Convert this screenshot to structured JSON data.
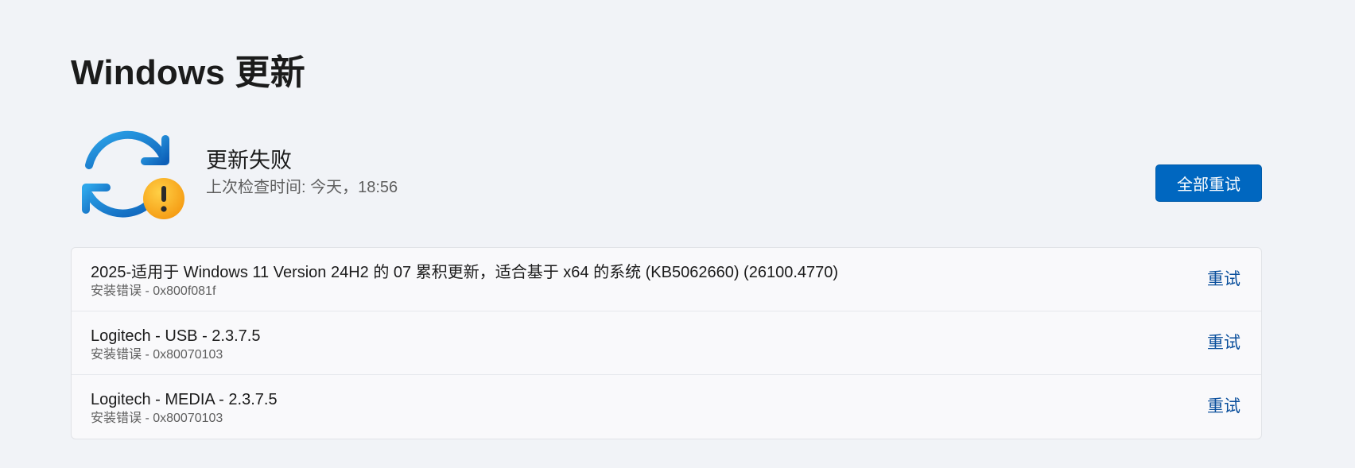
{
  "page": {
    "title": "Windows 更新"
  },
  "status": {
    "icon": "sync-warning-icon",
    "title": "更新失败",
    "last_checked": "上次检查时间: 今天，18:56",
    "retry_all_label": "全部重试"
  },
  "updates": [
    {
      "name": "2025-适用于 Windows 11 Version 24H2 的 07 累积更新，适合基于 x64 的系统 (KB5062660) (26100.4770)",
      "error": "安装错误 - 0x800f081f",
      "retry_label": "重试"
    },
    {
      "name": "Logitech - USB - 2.3.7.5",
      "error": "安装错误 - 0x80070103",
      "retry_label": "重试"
    },
    {
      "name": "Logitech - MEDIA - 2.3.7.5",
      "error": "安装错误 - 0x80070103",
      "retry_label": "重试"
    }
  ],
  "colors": {
    "accent": "#0067c0",
    "warning": "#f7a11a",
    "link": "#0a4f9c",
    "background": "#f1f3f7"
  }
}
